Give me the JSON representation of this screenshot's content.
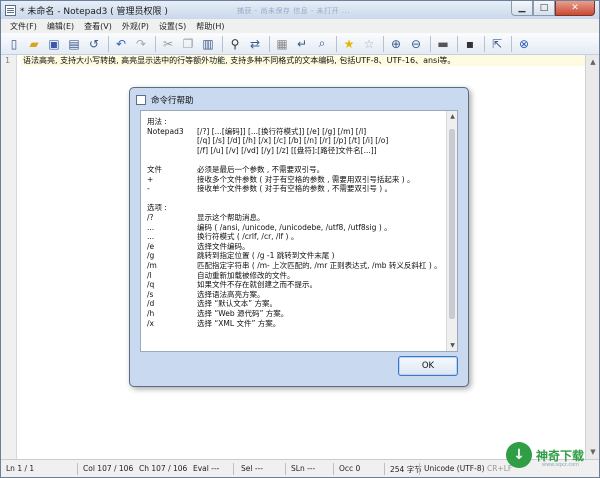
{
  "window": {
    "title": "* 未命名 - Notepad3 ( 管理员权限 )",
    "overlay_text": "捕获 - 尚未保存   信息 - 未打开   ..."
  },
  "menu": [
    "文件(F)",
    "编辑(E)",
    "查看(V)",
    "外观(P)",
    "设置(S)",
    "帮助(H)"
  ],
  "toolbar_icons": [
    "new-icon",
    "open-icon",
    "save-icon",
    "save-as-icon",
    "revert-icon",
    "undo-icon",
    "redo-icon",
    "cut-icon",
    "copy-icon",
    "paste-icon",
    "find-icon",
    "replace-icon",
    "print-icon",
    "wordwrap-icon",
    "zoom-icon",
    "favorite-icon",
    "add-favorite-icon",
    "zoom-in-icon",
    "zoom-out-icon",
    "scheme-icon",
    "customize-icon",
    "launch-icon",
    "exit-icon"
  ],
  "editor": {
    "line_number": "1",
    "line_text": "语法高亮, 支持大小写转换, 高亮显示选中的行等额外功能, 支持多种不同格式的文本编码, 包括UTF-8、UTF-16、ansi等。"
  },
  "dialog": {
    "title": "命令行帮助",
    "lines": [
      {
        "k": "用法 :",
        "v": ""
      },
      {
        "k": "Notepad3",
        "v": "[/?] [...[编码]] [...[换行符模式]] [/e] [/g] [/m] [/l]"
      },
      {
        "k": "",
        "v": "[/q] [/s] [/d] [/h] [/x] [/c] [/b] [/n] [/r] [/p] [/t] [/i] [/o]"
      },
      {
        "k": "",
        "v": "[/f] [/u] [/v] [/vd] [/y] [/z] [[盘符]:[路径]文件名[...]]"
      },
      {
        "k": "",
        "v": ""
      },
      {
        "k": "文件",
        "v": "必须是最后一个参数 , 不需要双引号。"
      },
      {
        "k": "+",
        "v": "接收多个文件参数 ( 对于有空格的参数 , 需要用双引号括起来 ) 。"
      },
      {
        "k": "-",
        "v": "接收单个文件参数 ( 对于有空格的参数 , 不需要双引号 ) 。"
      },
      {
        "k": "",
        "v": ""
      },
      {
        "k": "选项 :",
        "v": ""
      },
      {
        "k": "/?",
        "v": "显示这个帮助消息。"
      },
      {
        "k": "...",
        "v": "编码 ( /ansi, /unicode, /unicodebe, /utf8, /utf8sig ) 。"
      },
      {
        "k": "...",
        "v": "换行符模式 ( /crlf, /cr, /lf ) 。"
      },
      {
        "k": "/e",
        "v": "选择文件编码。"
      },
      {
        "k": "/g",
        "v": "跳转到指定位置 ( /g -1 跳转到文件末尾 )"
      },
      {
        "k": "/m",
        "v": "匹配指定字符串 ( /m- 上次匹配的, /mr 正则表达式, /mb 转义反斜杠 ) 。"
      },
      {
        "k": "/l",
        "v": "自动重新加载被修改的文件。"
      },
      {
        "k": "/q",
        "v": "如果文件不存在就创建之而不提示。"
      },
      {
        "k": "/s",
        "v": "选择语法高亮方案。"
      },
      {
        "k": "/d",
        "v": "选择 “默认文本” 方案。"
      },
      {
        "k": "/h",
        "v": "选择 “Web 源代码” 方案。"
      },
      {
        "k": "/x",
        "v": "选择 “XML 文件” 方案。"
      }
    ],
    "ok_label": "OK"
  },
  "status": {
    "ln": "Ln  1 / 1",
    "col": "Col  107 / 106",
    "ch": "Ch  107 / 106",
    "eval": "Eval  ---",
    "sel": "Sel  ---",
    "sln": "SLn  ---",
    "occ": "Occ  0",
    "bytes": "254 字节",
    "encoding": "Unicode (UTF-8)",
    "eol": "CR+LF"
  },
  "watermark": {
    "text": "神奇下载",
    "url": "www.sqxz.com"
  }
}
